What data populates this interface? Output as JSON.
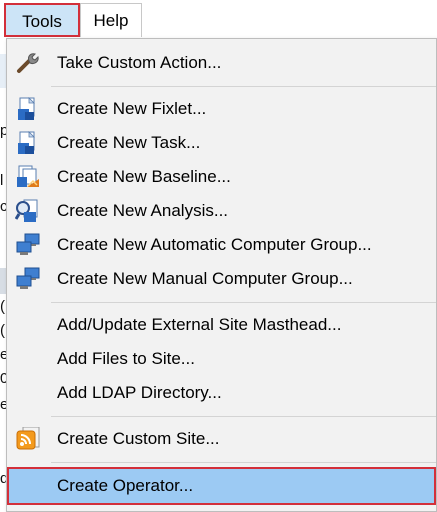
{
  "menubar": {
    "tools_label": "Tools",
    "help_label": "Help"
  },
  "background": {
    "chars": [
      "p",
      "l",
      "cl",
      "",
      "(",
      "(",
      "er",
      "0",
      "ec",
      "d"
    ]
  },
  "menu": {
    "items": [
      {
        "label": "Take Custom Action...",
        "icon": "wrench-icon"
      },
      {
        "label": "Create New Fixlet...",
        "icon": "fixlet-document-icon"
      },
      {
        "label": "Create New Task...",
        "icon": "task-document-icon"
      },
      {
        "label": "Create New Baseline...",
        "icon": "baseline-icon"
      },
      {
        "label": "Create New Analysis...",
        "icon": "analysis-icon"
      },
      {
        "label": "Create New Automatic Computer Group...",
        "icon": "computer-group-icon"
      },
      {
        "label": "Create New Manual Computer Group...",
        "icon": "computer-group-icon"
      },
      {
        "label": "Add/Update External Site Masthead...",
        "icon": ""
      },
      {
        "label": "Add Files to Site...",
        "icon": ""
      },
      {
        "label": "Add LDAP Directory...",
        "icon": ""
      },
      {
        "label": "Create Custom Site...",
        "icon": "rss-site-icon"
      },
      {
        "label": "Create Operator...",
        "icon": ""
      }
    ],
    "highlighted_item": "Create Operator..."
  },
  "colors": {
    "highlight": "#9ccaf3",
    "annotation_border": "#d32f3a",
    "menu_background": "#f2f2f2"
  }
}
